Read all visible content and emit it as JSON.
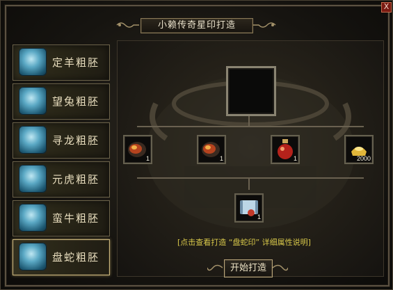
{
  "window": {
    "title": "小赖传奇星印打造",
    "close_label": "X"
  },
  "sidebar": {
    "items": [
      {
        "label": "定羊粗胚",
        "active": false
      },
      {
        "label": "望兔粗胚",
        "active": false
      },
      {
        "label": "寻龙粗胚",
        "active": false
      },
      {
        "label": "元虎粗胚",
        "active": false
      },
      {
        "label": "蛮牛粗胚",
        "active": false
      },
      {
        "label": "盘蛇粗胚",
        "active": true
      }
    ]
  },
  "crafting": {
    "materials": [
      {
        "icon": "ore-icon",
        "qty": "1"
      },
      {
        "icon": "ore-icon",
        "qty": "1"
      },
      {
        "icon": "potion-icon",
        "qty": "1"
      },
      {
        "icon": "gold-ingot-icon",
        "qty": "2000"
      }
    ],
    "result": {
      "icon": "scroll-icon",
      "qty": "1"
    },
    "detail_link": "[点击查看打造 “盘蛇印” 详细属性说明]",
    "start_button": "开始打造"
  },
  "colors": {
    "accent": "#c9b57c",
    "link": "#d8c84a",
    "icon_blue": "#5aa8c4"
  }
}
